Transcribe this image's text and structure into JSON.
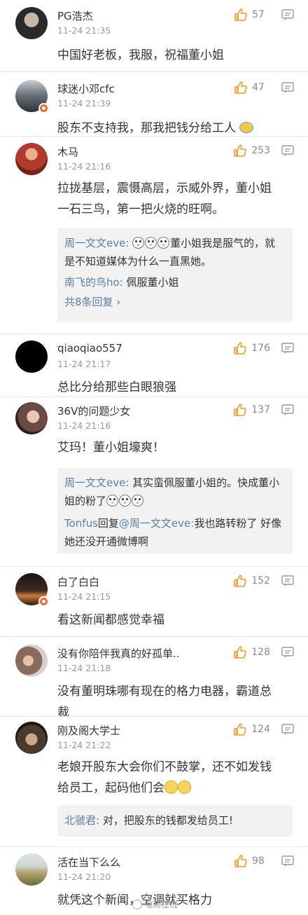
{
  "comments": [
    {
      "user": "PG浩杰",
      "time": "11-24 21:35",
      "likes": "57",
      "text": "中国好老板，我服，祝福董小姐",
      "avatar_color": "#2a2a2a"
    },
    {
      "user": "球迷小邓cfc",
      "time": "11-24 21:39",
      "likes": "47",
      "text": "股东不支持我，那我把钱分给工人",
      "avatar_color": "#5e6770"
    },
    {
      "user": "木马",
      "time": "11-24 21:16",
      "likes": "253",
      "text": "拉拢基层，震慑高层，示威外界，董小姐一石三鸟，第一把火烧的旺啊。",
      "avatar_color": "#b03a2e",
      "replies": {
        "r1_user": "周一文文eve:",
        "r1_text": "董小姐我是服气的，就是不知道媒体为什么一直黑她。",
        "r2_user": "南飞的鸟ho:",
        "r2_text": " 佩服董小姐",
        "more": "共8条回复 ›"
      }
    },
    {
      "user": "qiaoqiao557",
      "time": "11-24 21:17",
      "likes": "176",
      "text": "总比分给那些白眼狼强",
      "avatar_color": "#000000"
    },
    {
      "user": "36V的问题少女",
      "time": "11-24 21:16",
      "likes": "137",
      "text": "艾玛！董小姐壕爽！",
      "avatar_color": "#6b4a44",
      "replies": {
        "r1_user": "周一文文eve:",
        "r1_text": " 其实蛮佩服董小姐的。快成董小姐的粉了",
        "r2_user": "Tonfus",
        "r2_mid": "回复",
        "r2_target": "@周一文文eve:",
        "r2_text": "我也路转粉了 好像她还没开通微博啊"
      }
    },
    {
      "user": "白了白白",
      "time": "11-24 21:15",
      "likes": "152",
      "text": "看这新闻都感觉幸福",
      "avatar_color": "#3d2a1f"
    },
    {
      "user": "没有你陪伴我真的好孤单..",
      "time": "11-24 21:18",
      "likes": "128",
      "text": "没有董明珠哪有现在的格力电器，霸道总裁",
      "avatar_color": "#8a6a5a"
    },
    {
      "user": "刚及阁大学士",
      "time": "11-24 21:22",
      "likes": "124",
      "text": "老娘开股东大会你们不鼓掌，还不如发钱给员工，起码他们会",
      "avatar_color": "#4a3a2e",
      "replies": {
        "r1_user": "北虢君:",
        "r1_text": " 对，把股东的钱都发给员工!"
      }
    },
    {
      "user": "活在当下么么",
      "time": "11-24 21:20",
      "likes": "98",
      "text": "就凭这个新闻，空调就买格力",
      "avatar_color": "#b3a36a"
    }
  ],
  "watermark": "电商在线",
  "colors": {
    "like_orange": "#f3a43b",
    "link_blue": "#5b7ea8",
    "divider": "#e6e6e6"
  },
  "icons": {
    "like": "thumbs-up-icon",
    "reply": "comment-icon"
  }
}
